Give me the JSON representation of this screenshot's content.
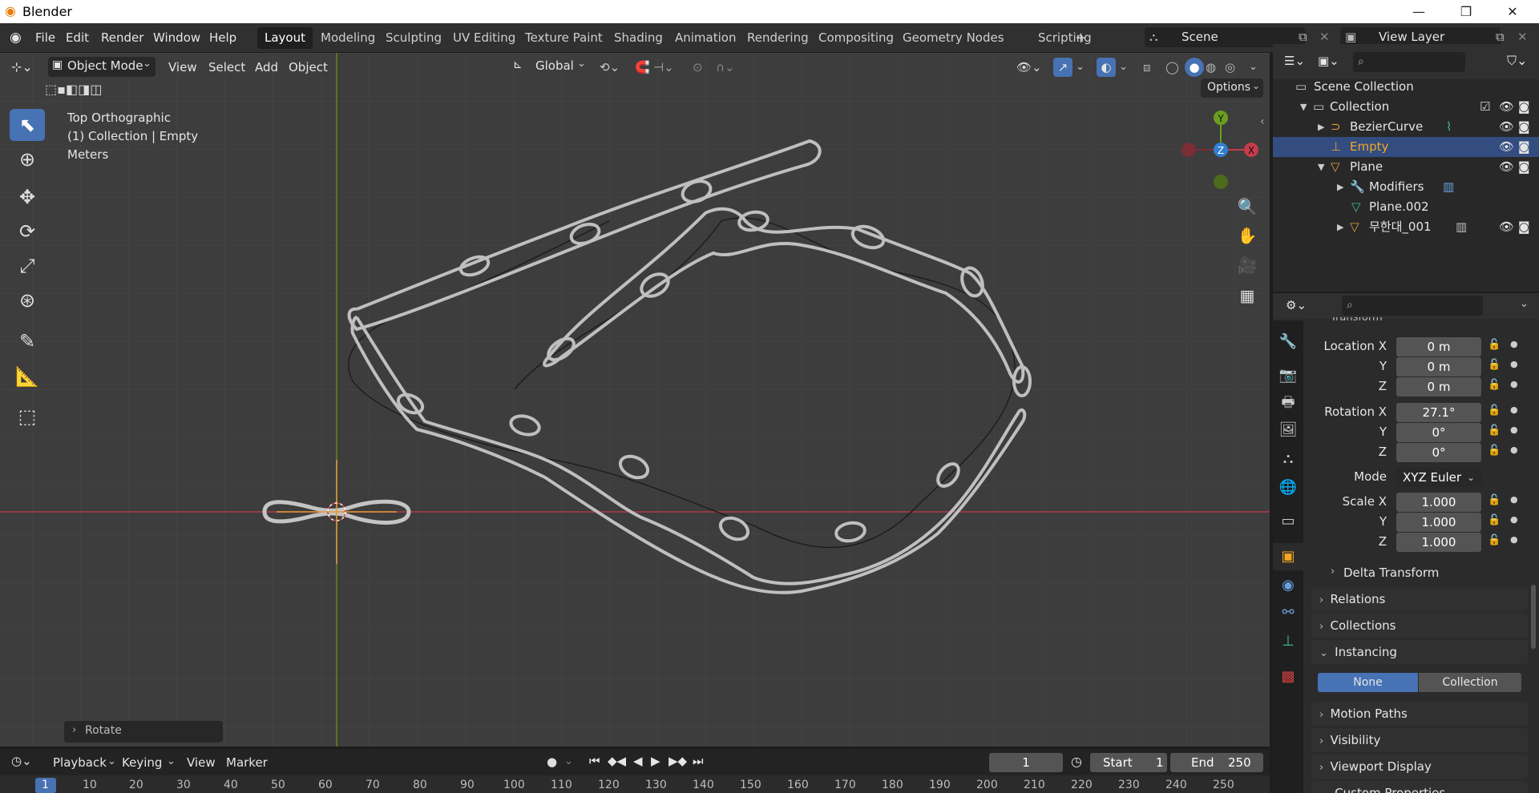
{
  "titlebar": {
    "app_title": "Blender",
    "minimize": "—",
    "maximize": "❐",
    "close": "✕"
  },
  "menubar": {
    "items": [
      "File",
      "Edit",
      "Render",
      "Window",
      "Help"
    ]
  },
  "workspaces": {
    "tabs": [
      "Layout",
      "Modeling",
      "Sculpting",
      "UV Editing",
      "Texture Paint",
      "Shading",
      "Animation",
      "Rendering",
      "Compositing",
      "Geometry Nodes",
      "Scripting"
    ],
    "active": "Layout",
    "add": "+"
  },
  "scene": {
    "label": "Scene",
    "view_layer": "View Layer"
  },
  "viewport_header": {
    "mode": "Object Mode",
    "menus": [
      "View",
      "Select",
      "Add",
      "Object"
    ],
    "orientation": "Global",
    "options": "Options"
  },
  "viewport_overlay": {
    "view_name": "Top Orthographic",
    "collection_info": "(1) Collection | Empty",
    "units": "Meters",
    "last_op": "Rotate"
  },
  "gizmo": {
    "y": "Y",
    "z": "Z",
    "x": "X"
  },
  "outliner": {
    "rows": [
      {
        "label": "Scene Collection",
        "indent": 0
      },
      {
        "label": "Collection",
        "indent": 1
      },
      {
        "label": "BezierCurve",
        "indent": 2
      },
      {
        "label": "Empty",
        "indent": 2,
        "selected": true
      },
      {
        "label": "Plane",
        "indent": 2
      },
      {
        "label": "Modifiers",
        "indent": 3
      },
      {
        "label": "Plane.002",
        "indent": 3
      },
      {
        "label": "무한대_001",
        "indent": 3
      }
    ]
  },
  "properties": {
    "section_partial": "Transform",
    "location": {
      "label": "Location X",
      "x": "0 m",
      "y": "0 m",
      "z": "0 m"
    },
    "rotation": {
      "label": "Rotation X",
      "x": "27.1°",
      "y": "0°",
      "z": "0°"
    },
    "mode_label": "Mode",
    "mode_value": "XYZ Euler",
    "scale": {
      "label": "Scale X",
      "x": "1.000",
      "y": "1.000",
      "z": "1.000"
    },
    "axis_y": "Y",
    "axis_z": "Z",
    "delta": "Delta Transform",
    "panels": [
      "Relations",
      "Collections",
      "Instancing",
      "Motion Paths",
      "Visibility",
      "Viewport Display",
      "Custom Properties"
    ],
    "instancing": {
      "none": "None",
      "collection": "Collection"
    }
  },
  "timeline": {
    "menus": [
      "Playback",
      "Keying",
      "View",
      "Marker"
    ],
    "current_frame": "1",
    "start_label": "Start",
    "start": "1",
    "end_label": "End",
    "end": "250",
    "ruler": [
      "1",
      "10",
      "20",
      "30",
      "40",
      "50",
      "60",
      "70",
      "80",
      "90",
      "100",
      "110",
      "120",
      "130",
      "140",
      "150",
      "160",
      "170",
      "180",
      "190",
      "200",
      "210",
      "220",
      "230",
      "240",
      "250"
    ]
  },
  "colors": {
    "accent": "#4772b3",
    "axis_x": "#c43c4b",
    "axis_y": "#6b9e1f",
    "selected_text": "#f5a623"
  }
}
